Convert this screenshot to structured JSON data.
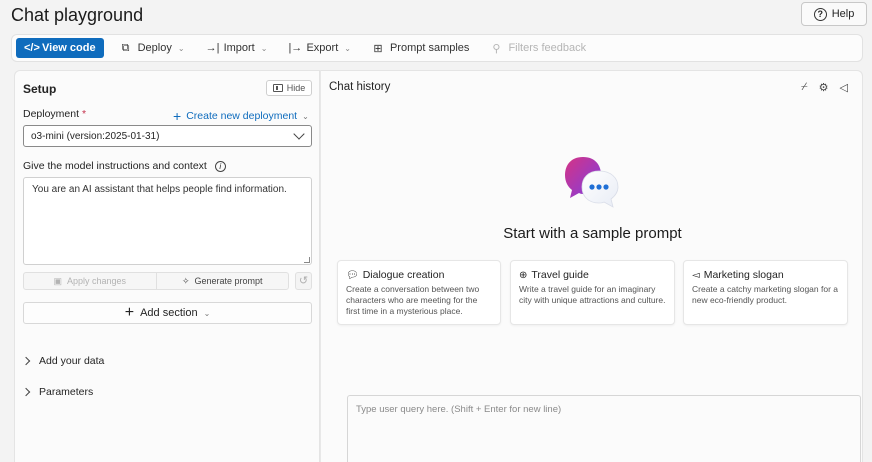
{
  "page": {
    "title": "Chat playground",
    "help_label": "Help"
  },
  "toolbar": {
    "view_code": "View code",
    "deploy": "Deploy",
    "import": "Import",
    "export": "Export",
    "prompt_samples": "Prompt samples",
    "filters_feedback": "Filters feedback"
  },
  "setup": {
    "title": "Setup",
    "hide_label": "Hide",
    "deployment_label": "Deployment",
    "required_mark": "*",
    "create_deployment": "Create new deployment",
    "deployment_value": "o3-mini (version:2025-01-31)",
    "instructions_label": "Give the model instructions and context",
    "instructions_value": "You are an AI assistant that helps people find information.",
    "apply_changes": "Apply changes",
    "generate_prompt": "Generate prompt",
    "add_section": "Add section",
    "add_your_data": "Add your data",
    "parameters": "Parameters"
  },
  "chat": {
    "title": "Chat history",
    "start_text": "Start with a sample prompt",
    "cards": [
      {
        "title": "Dialogue creation",
        "desc": "Create a conversation between two characters who are meeting for the first time in a mysterious place.",
        "icon": "chat-bubble-icon"
      },
      {
        "title": "Travel guide",
        "desc": "Write a travel guide for an imaginary city with unique attractions and culture.",
        "icon": "globe-icon"
      },
      {
        "title": "Marketing slogan",
        "desc": "Create a catchy marketing slogan for a new eco-friendly product.",
        "icon": "megaphone-icon"
      }
    ],
    "query_placeholder": "Type user query here. (Shift + Enter for new line)"
  },
  "colors": {
    "accent": "#0f6cbd",
    "logo_purple": "#7b3fe4",
    "logo_pink": "#d63384",
    "logo_blue": "#1f6fd6"
  }
}
